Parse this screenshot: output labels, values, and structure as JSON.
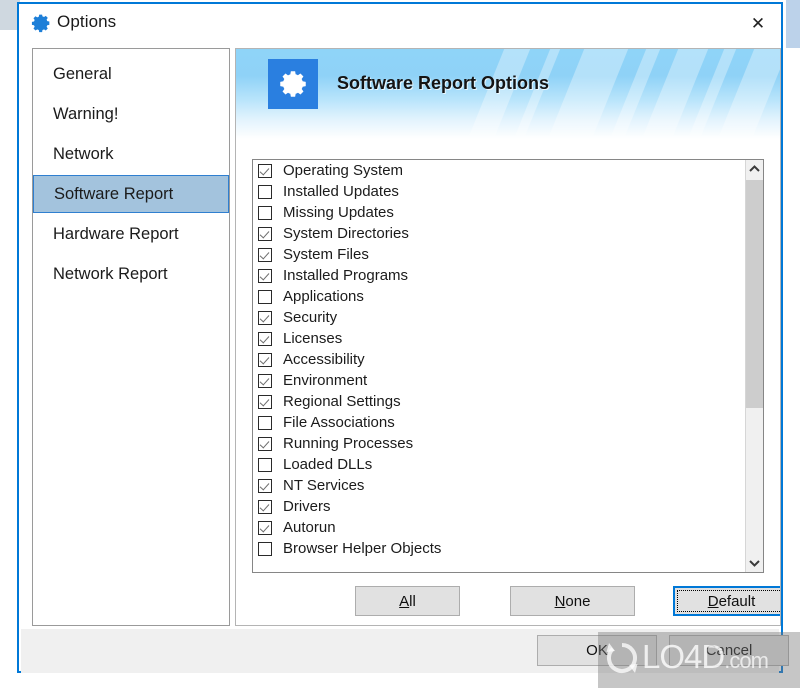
{
  "window": {
    "title": "Options",
    "title_icon": "gear-icon",
    "close_label": "✕",
    "accent_color": "#0078d7"
  },
  "sidebar": {
    "items": [
      {
        "label": "General",
        "selected": false
      },
      {
        "label": "Warning!",
        "selected": false
      },
      {
        "label": "Network",
        "selected": false
      },
      {
        "label": "Software Report",
        "selected": true
      },
      {
        "label": "Hardware Report",
        "selected": false
      },
      {
        "label": "Network Report",
        "selected": false
      }
    ],
    "selected_color": "#a3c3dd"
  },
  "content": {
    "banner": {
      "title": "Software Report Options",
      "icon": "gear-icon",
      "icon_bg": "#2a7fe0",
      "gradient_top": "#8fd4f8",
      "gradient_bottom": "#ffffff"
    },
    "list": {
      "items": [
        {
          "label": "Operating System",
          "checked": true
        },
        {
          "label": "Installed Updates",
          "checked": false
        },
        {
          "label": "Missing Updates",
          "checked": false
        },
        {
          "label": "System Directories",
          "checked": true
        },
        {
          "label": "System Files",
          "checked": true
        },
        {
          "label": "Installed Programs",
          "checked": true
        },
        {
          "label": "Applications",
          "checked": false
        },
        {
          "label": "Security",
          "checked": true
        },
        {
          "label": "Licenses",
          "checked": true
        },
        {
          "label": "Accessibility",
          "checked": true
        },
        {
          "label": "Environment",
          "checked": true
        },
        {
          "label": "Regional Settings",
          "checked": true
        },
        {
          "label": "File Associations",
          "checked": false
        },
        {
          "label": "Running Processes",
          "checked": true
        },
        {
          "label": "Loaded DLLs",
          "checked": false
        },
        {
          "label": "NT Services",
          "checked": true
        },
        {
          "label": "Drivers",
          "checked": true
        },
        {
          "label": "Autorun",
          "checked": true
        },
        {
          "label": "Browser Helper Objects",
          "checked": false
        }
      ],
      "scrollbar": {
        "up_icon": "chevron-up-icon",
        "down_icon": "chevron-down-icon",
        "thumb_position_percent": 0,
        "thumb_size_percent": 60
      }
    },
    "actions": [
      {
        "key": "all",
        "label": "All",
        "accel": "A",
        "focused": false
      },
      {
        "key": "none",
        "label": "None",
        "accel": "N",
        "focused": false
      },
      {
        "key": "default",
        "label": "Default",
        "accel": "D",
        "focused": true
      }
    ]
  },
  "footer": {
    "ok_label": "OK",
    "cancel_label": "Cancel"
  },
  "watermark": {
    "text": "LO4D",
    "suffix": ".com",
    "logo": "refresh-circle-icon"
  }
}
